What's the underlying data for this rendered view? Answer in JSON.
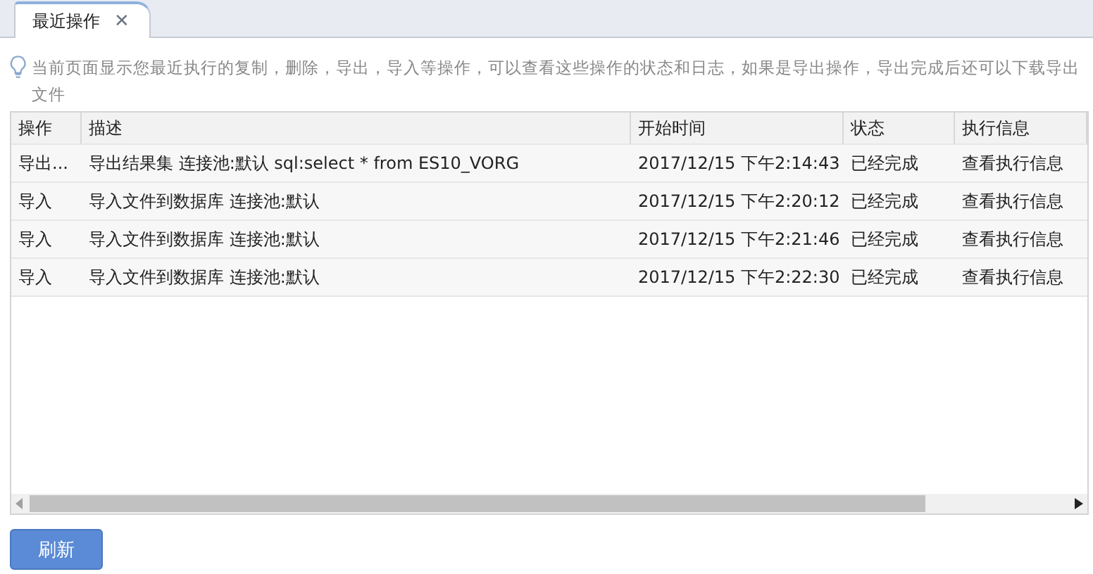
{
  "tabs": [
    {
      "label": "最近操作",
      "selected": true,
      "close": "✕"
    }
  ],
  "info": "当前页面显示您最近执行的复制，删除，导出，导入等操作，可以查看这些操作的状态和日志，如果是导出操作，导出完成后还可以下载导出文件",
  "table": {
    "columns": [
      "操作",
      "描述",
      "开始时间",
      "状态",
      "执行信息"
    ],
    "rows": [
      [
        "导出...",
        "导出结果集 连接池:默认 sql:select * from ES10_VORG",
        "2017/12/15 下午2:14:43",
        "已经完成",
        "查看执行信息"
      ],
      [
        "导入",
        "导入文件到数据库 连接池:默认",
        "2017/12/15 下午2:20:12",
        "已经完成",
        "查看执行信息"
      ],
      [
        "导入",
        "导入文件到数据库 连接池:默认",
        "2017/12/15 下午2:21:46",
        "已经完成",
        "查看执行信息"
      ],
      [
        "导入",
        "导入文件到数据库 连接池:默认",
        "2017/12/15 下午2:22:30",
        "已经完成",
        "查看执行信息"
      ]
    ]
  },
  "buttons": [
    "刷新"
  ]
}
